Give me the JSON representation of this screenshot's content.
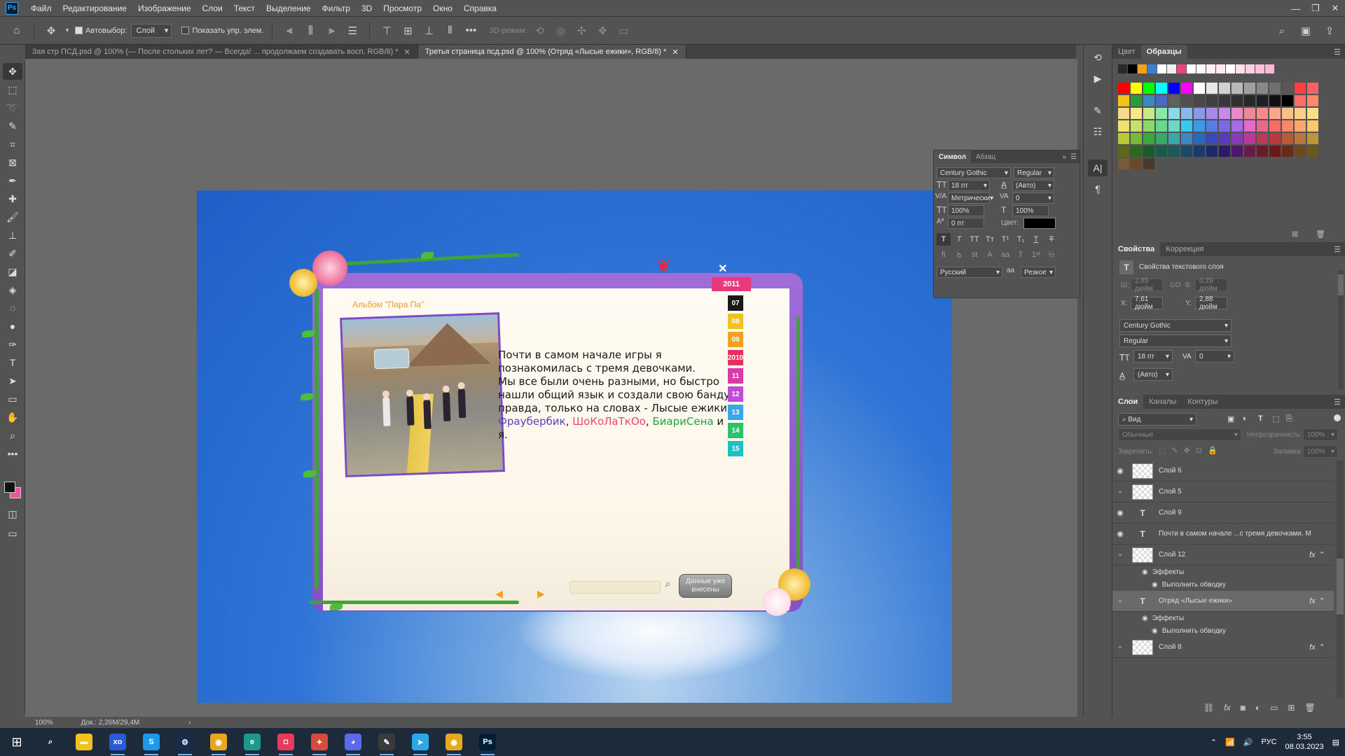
{
  "app": {
    "logo": "Ps"
  },
  "menu": [
    "Файл",
    "Редактирование",
    "Изображение",
    "Слои",
    "Текст",
    "Выделение",
    "Фильтр",
    "3D",
    "Просмотр",
    "Окно",
    "Справка"
  ],
  "options": {
    "autoselect_label": "Автовыбор:",
    "autoselect_value": "Слой",
    "show_controls_label": "Показать упр. элем.",
    "mode3d_label": "3D-режим:"
  },
  "tabs": [
    {
      "label": "3ая стр ПСД.psd @ 100% (— После стольких лет? — Всегда! ... продолжаем создавать восп, RGB/8) *"
    },
    {
      "label": "Третья страница псд.psd @ 100% (Отряд «Лысые ежики», RGB/8) *"
    }
  ],
  "canvas": {
    "album_title": "Альбом \"Пара Па\"",
    "year": "2011",
    "month_tabs": [
      {
        "label": "07",
        "color": "#1a1a1a"
      },
      {
        "label": "08",
        "color": "#f2c21c"
      },
      {
        "label": "09",
        "color": "#f2a21c"
      },
      {
        "label": "2010",
        "color": "#e8305a"
      },
      {
        "label": "11",
        "color": "#d83aa8"
      },
      {
        "label": "12",
        "color": "#c24ad8"
      },
      {
        "label": "13",
        "color": "#3aa8e8"
      },
      {
        "label": "14",
        "color": "#2cc26a"
      },
      {
        "label": "15",
        "color": "#1ac2c8"
      }
    ],
    "story_lines": [
      "Почти в самом начале игры я",
      "познакомилась с тремя девочками.",
      "Мы все были очень разными, но быстро",
      "нашли общий язык и создали свою банду,",
      "правда, только на словах - Лысые ежики."
    ],
    "names": {
      "n1": "Фраубербик",
      "sep1": ", ",
      "n2": "ШоКоЛаТкОо",
      "sep2": ", ",
      "n3": "БиариСена",
      "tail": " и я."
    },
    "data_button": "Данные уже внесены"
  },
  "character": {
    "tabs": [
      "Символ",
      "Абзац"
    ],
    "font_family": "Century Gothic",
    "font_style": "Regular",
    "size": "18 пт",
    "leading": "(Авто)",
    "kerning": "Метрически",
    "tracking": "0",
    "vscale": "100%",
    "hscale": "100%",
    "baseline": "0 пт",
    "color_label": "Цвет:",
    "language": "Русский",
    "aa_label": "аа",
    "antialias": "Резкое"
  },
  "swatches_panel": {
    "tabs": [
      "Цвет",
      "Образцы"
    ],
    "recent": [
      "#2a2a2a",
      "#000000",
      "#f2a21c",
      "#3a7fd8",
      "#ffffff",
      "#f0f0f0",
      "#f0447a",
      "#ffffff",
      "#f8f8f8",
      "#fff0f4",
      "#ffe8f0",
      "#ffffff",
      "#fde0ec",
      "#ffd0e4",
      "#ffc0dc",
      "#f8b8d4"
    ],
    "grid": [
      [
        "#ff0000",
        "#ffff00",
        "#00ff00",
        "#00ffff",
        "#0000ff",
        "#ff00ff",
        "#ffffff",
        "#e8e8e8",
        "#d0d0d0",
        "#b8b8b8",
        "#a0a0a0",
        "#888888",
        "#707070",
        "#585858",
        "#ff4040",
        "#ff6060"
      ],
      [
        "#f2c21c",
        "#2a9a3a",
        "#3a8ac2",
        "#4a6ac2",
        "#606060",
        "#505050",
        "#484848",
        "#404040",
        "#383838",
        "#303030",
        "#282828",
        "#202020",
        "#101010",
        "#000000",
        "#ff6a6a",
        "#ff8a6a"
      ],
      [
        "#f8d88a",
        "#f8e88a",
        "#c8e88a",
        "#8ae8a8",
        "#8ad8e8",
        "#8ab8e8",
        "#8a98e8",
        "#a88ae8",
        "#c88ae8",
        "#e88ac8",
        "#e88a9a",
        "#f88a8a",
        "#f8a88a",
        "#f8c08a",
        "#f8d08a",
        "#f8e08a"
      ],
      [
        "#f2e06a",
        "#c8e06a",
        "#8ad86a",
        "#6ad88a",
        "#6ad8c8",
        "#38c8f8",
        "#3a9ae8",
        "#5a7ae8",
        "#7a6ae8",
        "#a86ae8",
        "#e86ac8",
        "#e86a8a",
        "#f86a6a",
        "#f8886a",
        "#f8a86a",
        "#f8c86a"
      ],
      [
        "#b8c83a",
        "#7ab83a",
        "#3aa83a",
        "#3aa86a",
        "#3aa8a8",
        "#3a88c8",
        "#2a68b8",
        "#3a48b8",
        "#5a3ab8",
        "#883ab8",
        "#b83a98",
        "#b83a5a",
        "#b83a3a",
        "#b85a3a",
        "#b8783a",
        "#b8983a"
      ],
      [
        "#5a6a1a",
        "#2a6a1a",
        "#1a5a2a",
        "#1a5a4a",
        "#1a5a5a",
        "#1a4a6a",
        "#1a3a6a",
        "#1a2a6a",
        "#2a1a6a",
        "#4a1a6a",
        "#6a1a4a",
        "#6a1a2a",
        "#6a1a1a",
        "#6a2a1a",
        "#6a4a1a",
        "#6a5a1a"
      ],
      [
        "#7a5a3a",
        "#6a4a2a",
        "#4a3a2a"
      ]
    ]
  },
  "properties": {
    "tabs": [
      "Свойства",
      "Коррекция"
    ],
    "subtitle": "Свойства текстового слоя",
    "w_label": "Ш:",
    "w_value": "2,85 дюйм",
    "link_label": "GO",
    "h_label": "В:",
    "h_value": "0,29 дюйм",
    "x_label": "X:",
    "x_value": "7,61 дюйм",
    "y_label": "Y:",
    "y_value": "2,88 дюйм",
    "font_family": "Century Gothic",
    "font_style": "Regular",
    "size": "18 пт",
    "tracking": "0",
    "leading": "(Авто)"
  },
  "layers_panel": {
    "tabs": [
      "Слои",
      "Каналы",
      "Контуры"
    ],
    "filter_label": "Вид",
    "blend_mode": "Обычные",
    "opacity_label": "Непрозрачность:",
    "opacity": "100%",
    "lock_label": "Закрепить:",
    "fill_label": "Заливка:",
    "fill": "100%",
    "rows": [
      {
        "name": "Слой 6",
        "type": "image",
        "visible": true
      },
      {
        "name": "Слой 5",
        "type": "image",
        "visible": false
      },
      {
        "name": "Слой 9",
        "type": "text",
        "visible": true
      },
      {
        "name": "Почти в самом начале ...с тремя девочками. М",
        "type": "text",
        "visible": true
      },
      {
        "name": "Слой 12",
        "type": "image",
        "visible": false,
        "fx": true
      },
      {
        "name": "Эффекты",
        "type": "sub"
      },
      {
        "name": "Выполнить обводку",
        "type": "sub2"
      },
      {
        "name": "Отряд «Лысые ежики»",
        "type": "text",
        "visible": false,
        "fx": true,
        "selected": true
      },
      {
        "name": "Эффекты",
        "type": "sub"
      },
      {
        "name": "Выполнить обводку",
        "type": "sub2"
      },
      {
        "name": "Слой 8",
        "type": "image",
        "visible": false,
        "fx": true
      }
    ]
  },
  "status": {
    "zoom": "100%",
    "doc": "Док.: 2,26M/29,4M"
  },
  "taskbar": {
    "lang": "РУС",
    "time": "3:55",
    "date": "08.03.2023",
    "apps": [
      {
        "name": "search",
        "glyph": "⌕",
        "color": "transparent"
      },
      {
        "name": "explorer",
        "glyph": "▬",
        "color": "#f2c21c"
      },
      {
        "name": "xbox",
        "glyph": "xo",
        "color": "#2a5ad8"
      },
      {
        "name": "skype",
        "glyph": "S",
        "color": "#1a9ae8"
      },
      {
        "name": "steam",
        "glyph": "⚙",
        "color": "#1a2a4a"
      },
      {
        "name": "chrome",
        "glyph": "◉",
        "color": "#e8a81c"
      },
      {
        "name": "edge",
        "glyph": "e",
        "color": "#1a9a8a"
      },
      {
        "name": "camera",
        "glyph": "◘",
        "color": "#e83a5a"
      },
      {
        "name": "game",
        "glyph": "✦",
        "color": "#d84a3a"
      },
      {
        "name": "discord",
        "glyph": "◕",
        "color": "#5a6ae8"
      },
      {
        "name": "paint",
        "glyph": "✎",
        "color": "#3a3a3a"
      },
      {
        "name": "telegram",
        "glyph": "➤",
        "color": "#2aa8e8"
      },
      {
        "name": "chrome2",
        "glyph": "◉",
        "color": "#e8a81c"
      },
      {
        "name": "photoshop",
        "glyph": "Ps",
        "color": "#001e36"
      }
    ]
  }
}
